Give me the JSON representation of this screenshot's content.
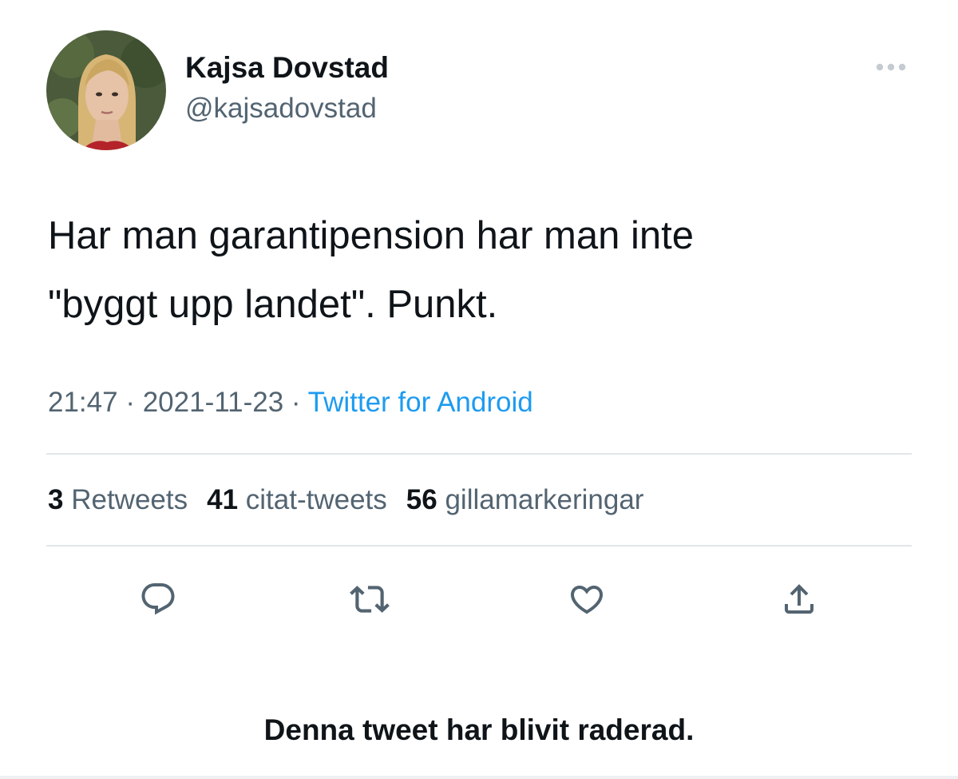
{
  "author": {
    "name": "Kajsa Dovstad",
    "handle": "@kajsadovstad"
  },
  "tweet": {
    "text_line1": "Har man garantipension har man inte",
    "text_line2": "\"byggt upp landet\". Punkt.",
    "time": "21:47",
    "date": "2021-11-23",
    "separator": "·",
    "source": "Twitter for Android"
  },
  "stats": {
    "retweets_count": "3",
    "retweets_label": "Retweets",
    "quotes_count": "41",
    "quotes_label": "citat-tweets",
    "likes_count": "56",
    "likes_label": "gillamarkeringar"
  },
  "actions": {
    "icons": [
      "reply-icon",
      "retweet-icon",
      "like-icon",
      "share-icon"
    ]
  },
  "notice": "Denna tweet har blivit raderad.",
  "colors": {
    "text_primary": "#0f1419",
    "text_secondary": "#536471",
    "link": "#1d9bf0",
    "divider": "#e1e6ea"
  }
}
